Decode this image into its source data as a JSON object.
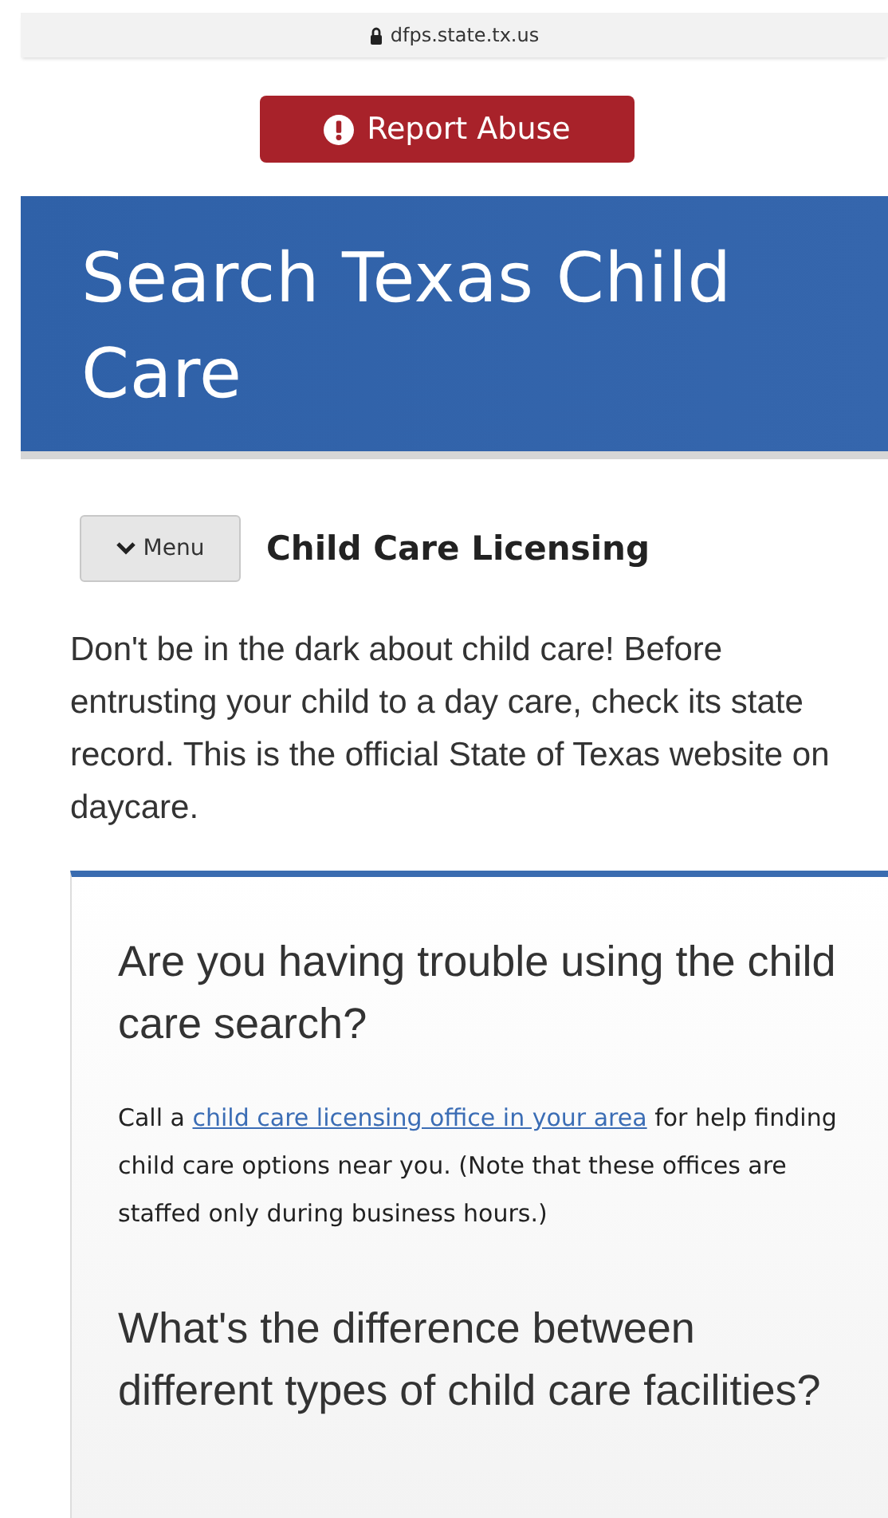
{
  "address_bar": {
    "url": "dfps.state.tx.us"
  },
  "report_button": {
    "label": "Report Abuse"
  },
  "banner": {
    "title": "Search Texas Child Care"
  },
  "nav": {
    "menu_button": "Menu",
    "section_title": "Child Care Licensing"
  },
  "intro": "Don't be in the dark about child care! Before entrusting your child to a day care, check its state record. This is the official State of Texas website on daycare.",
  "help_card": {
    "sections": [
      {
        "heading": "Are you having trouble using the child care search?",
        "text_before": "Call a",
        "link": "child care licensing office in your area",
        "text_after": "for help finding child care options near you. (Note that these offices are staffed only during business hours.)"
      },
      {
        "heading": "What's the difference between different types of child care facilities?"
      }
    ]
  }
}
